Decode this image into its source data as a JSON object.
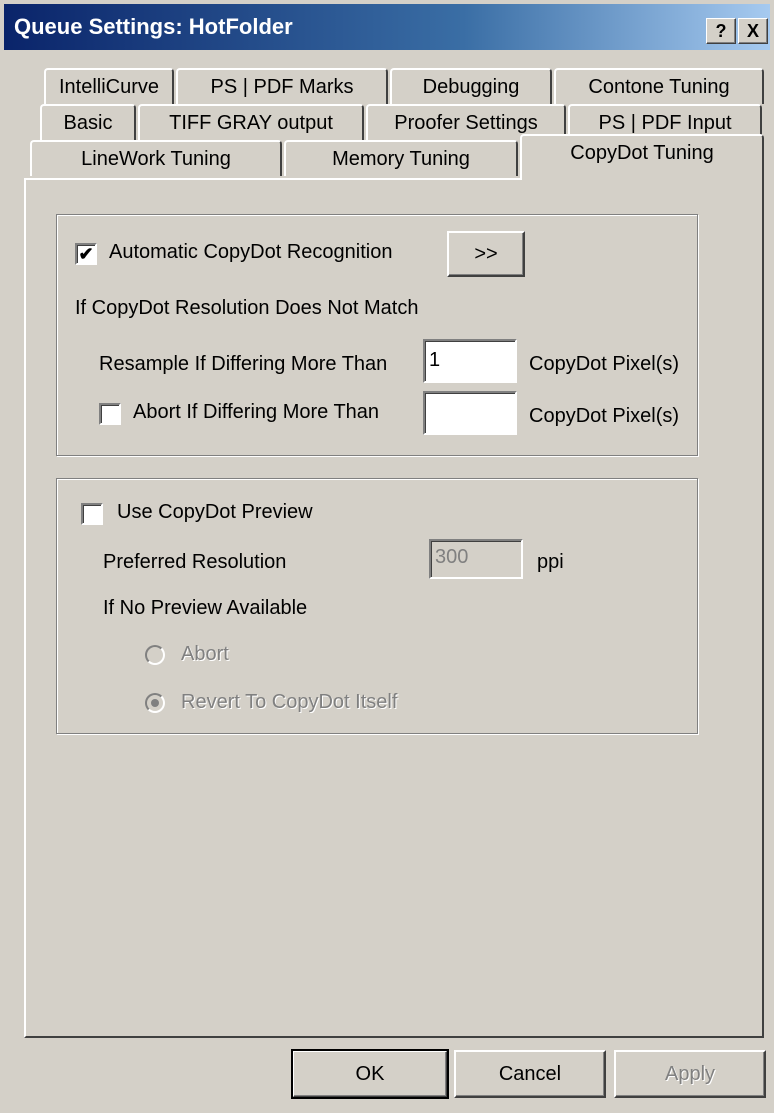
{
  "window": {
    "title": "Queue Settings: HotFolder",
    "help_label": "?",
    "close_label": "X"
  },
  "tabs": {
    "row1": [
      "IntelliCurve",
      "PS | PDF Marks",
      "Debugging",
      "Contone Tuning"
    ],
    "row2": [
      "Basic",
      "TIFF GRAY output",
      "Proofer Settings",
      "PS | PDF Input"
    ],
    "row3": [
      "LineWork Tuning",
      "Memory Tuning",
      "CopyDot Tuning"
    ],
    "active": "CopyDot Tuning"
  },
  "recognition": {
    "auto_label": "Automatic CopyDot Recognition",
    "auto_checked": true,
    "more_button": ">>",
    "mismatch_label": "If CopyDot Resolution Does Not Match",
    "resample_label": "Resample If Differing More Than",
    "resample_value": "1",
    "resample_unit": "CopyDot Pixel(s)",
    "abort_label": "Abort If Differing More Than",
    "abort_checked": false,
    "abort_value": "",
    "abort_unit": "CopyDot Pixel(s)"
  },
  "preview": {
    "use_label": "Use CopyDot Preview",
    "use_checked": false,
    "resolution_label": "Preferred Resolution",
    "resolution_value": "300",
    "resolution_unit": "ppi",
    "no_preview_label": "If No Preview Available",
    "option_abort": "Abort",
    "option_revert": "Revert To CopyDot Itself",
    "selected": "Revert To CopyDot Itself"
  },
  "footer": {
    "ok": "OK",
    "cancel": "Cancel",
    "apply": "Apply"
  },
  "colors": {
    "face": "#d4d0c8",
    "title_start": "#0a246a",
    "title_end": "#a6caf0",
    "disabled_text": "#808080"
  }
}
